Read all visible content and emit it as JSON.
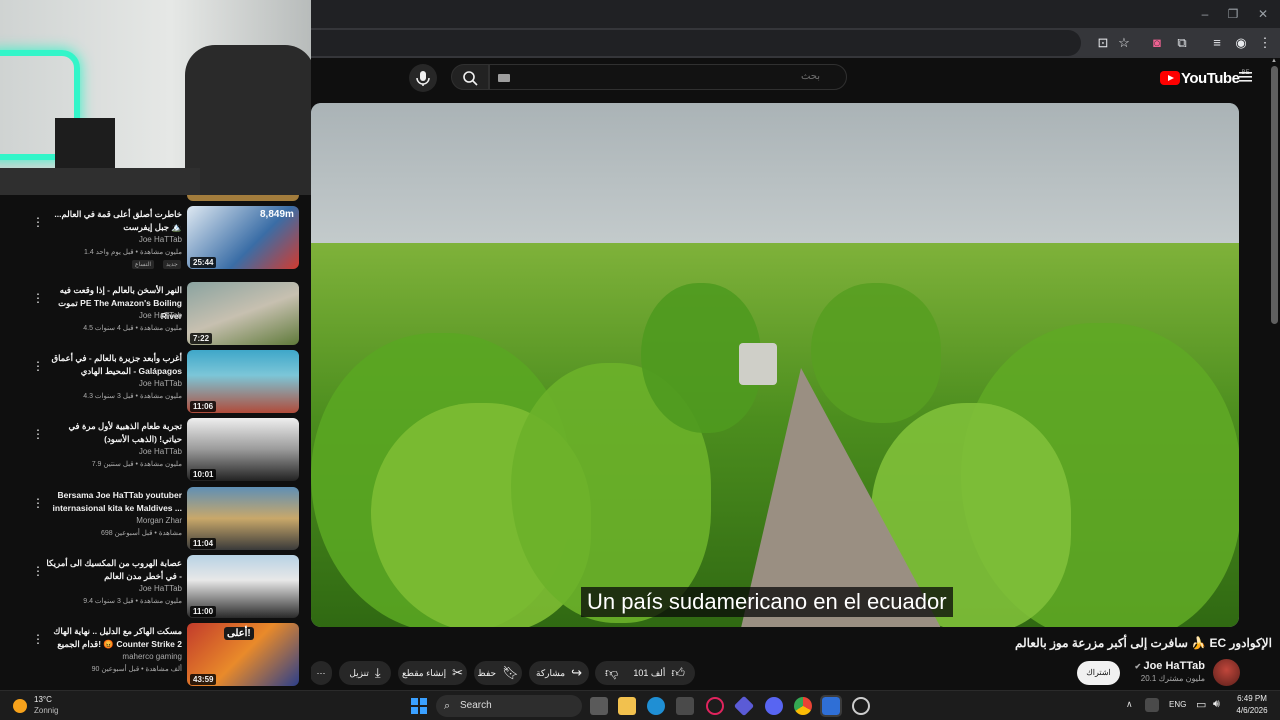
{
  "browser": {
    "window_controls": [
      "–",
      "❐",
      "✕"
    ],
    "toolbar_icons": [
      "install-icon",
      "star-icon",
      "extension-icon",
      "puzzle-icon",
      "media-icon",
      "profile-icon",
      "menu-icon"
    ]
  },
  "youtube": {
    "logo_text": "YouTube",
    "logo_country": "BE",
    "search_placeholder": "بحث"
  },
  "video": {
    "subtitle": "Un país sudamericano en el ecuador",
    "title": "سافرت إلى أكبر مزرعة موز بالعالم 🍌 EC الإكوادور",
    "channel": "Joe HaTTab",
    "subscribers": "20.1 مليون مشترك",
    "subscribe_label": "اشتراك",
    "likes": "101 ألف",
    "share_label": "مشاركة",
    "save_label": "حفظ",
    "clip_label": "إنشاء مقطع",
    "download_label": "تنزيل"
  },
  "related": [
    {
      "title": "خاطرت أصلق أعلى قمة في العالم... جبل إيفرست 🏔️",
      "channel": "Joe HaTTab",
      "meta": "1.4 مليون مشاهدة • قبل يوم واحد",
      "duration": "25:44",
      "overlay": "8,849m",
      "badges": [
        "جديد",
        "التساع"
      ]
    },
    {
      "title": "النهر الأسخن بالعالم - إذا وقعت فيه تموت PE The Amazon's Boiling River",
      "channel": "Joe HaTTab",
      "meta": "4.5 مليون مشاهدة • قبل 4 سنوات",
      "duration": "7:22"
    },
    {
      "title": "أغرب وأبعد جزيرة بالعالم - في أعماق المحيط الهادي - Galápagos",
      "channel": "Joe HaTTab",
      "meta": "4.3 مليون مشاهدة • قبل 3 سنوات",
      "duration": "11:06"
    },
    {
      "title": "تجربة طعام الذهبية لأول مرة في حياتي! (الذهب الأسود)",
      "channel": "Joe HaTTab",
      "meta": "7.9 مليون مشاهدة • قبل سنتين",
      "duration": "10:01"
    },
    {
      "title": "Bersama Joe HaTTab youtuber internasional kita ke Maldives ...",
      "channel": "Morgan Zhar",
      "meta": "698 مشاهدة • قبل أسبوعين",
      "duration": "11:04"
    },
    {
      "title": "عصابة الهروب من المكسيك الى أمريكا - في أخطر مدن العالم",
      "channel": "Joe HaTTab",
      "meta": "9.4 مليون مشاهدة • قبل 3 سنوات",
      "duration": "11:00"
    },
    {
      "title": "مسكت الهاكر مع الدليل .. نهاية الهاك قدام الجميع! 😡 Counter Strike 2",
      "channel": "maherco gaming",
      "meta": "90 ألف مشاهدة • قبل أسبوعين",
      "duration": "43:59",
      "overlay": "أعلى!"
    }
  ],
  "taskbar": {
    "temperature": "13°C",
    "weather": "Zonnig",
    "search_label": "Search",
    "language": "ENG",
    "time": "6:49 PM",
    "date": "4/6/2026"
  }
}
